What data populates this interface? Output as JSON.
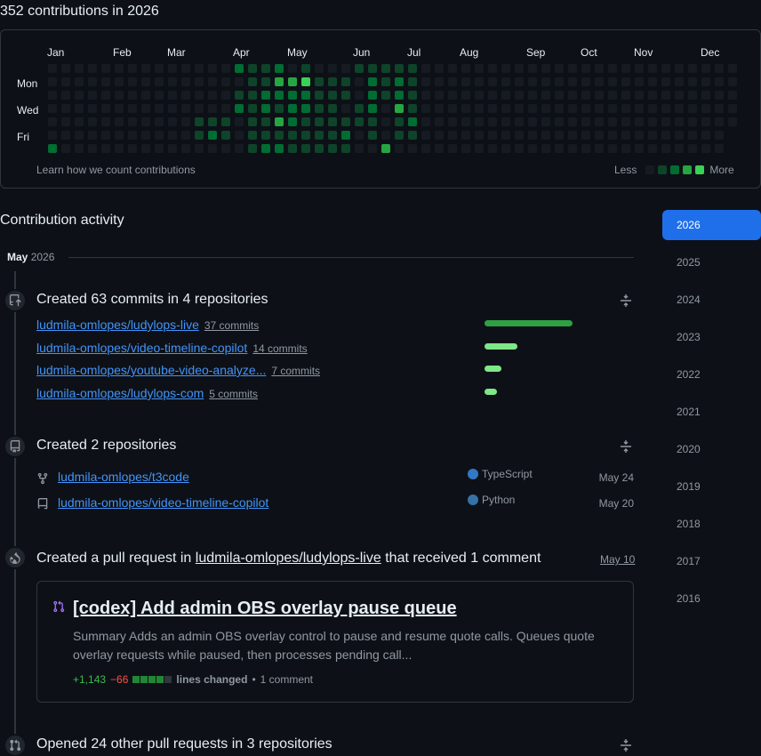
{
  "contributions": {
    "title": "352 contributions in 2026",
    "months": [
      "Jan",
      "Feb",
      "Mar",
      "Apr",
      "May",
      "Jun",
      "Jul",
      "Aug",
      "Sep",
      "Oct",
      "Nov",
      "Dec"
    ],
    "day_labels": [
      "Mon",
      "Wed",
      "Fri"
    ],
    "learn_link": "Learn how we count contributions",
    "legend_less": "Less",
    "legend_more": "More",
    "colors": [
      "#161b22",
      "#0e4429",
      "#006d32",
      "#26a641",
      "#39d353"
    ],
    "active_weeks": [
      [
        0,
        0,
        0,
        0,
        0,
        0,
        2
      ],
      [
        0,
        0,
        0,
        0,
        0,
        0,
        0
      ],
      [
        0,
        0,
        0,
        0,
        0,
        0,
        0
      ],
      [
        0,
        0,
        0,
        0,
        0,
        0,
        0
      ],
      [
        0,
        0,
        0,
        0,
        0,
        0,
        0
      ],
      [
        0,
        0,
        0,
        0,
        0,
        0,
        0
      ],
      [
        0,
        0,
        0,
        0,
        0,
        0,
        0
      ],
      [
        0,
        0,
        0,
        0,
        0,
        0,
        0
      ],
      [
        0,
        0,
        0,
        0,
        0,
        0,
        0
      ],
      [
        0,
        0,
        0,
        0,
        0,
        0,
        0
      ],
      [
        0,
        0,
        0,
        0,
        0,
        0,
        0
      ],
      [
        0,
        0,
        0,
        0,
        1,
        1,
        0
      ],
      [
        0,
        0,
        0,
        0,
        1,
        2,
        0
      ],
      [
        0,
        0,
        0,
        0,
        1,
        1,
        0
      ],
      [
        2,
        0,
        1,
        2,
        0,
        0,
        0
      ],
      [
        1,
        1,
        1,
        1,
        1,
        1,
        1
      ],
      [
        1,
        1,
        2,
        2,
        1,
        1,
        2
      ],
      [
        2,
        3,
        2,
        1,
        3,
        1,
        2
      ],
      [
        0,
        3,
        2,
        2,
        2,
        1,
        1
      ],
      [
        1,
        4,
        2,
        2,
        1,
        1,
        1
      ],
      [
        0,
        1,
        1,
        1,
        1,
        1,
        1
      ],
      [
        0,
        1,
        1,
        1,
        1,
        1,
        1
      ],
      [
        0,
        1,
        1,
        0,
        1,
        2,
        1
      ],
      [
        1,
        0,
        0,
        1,
        1,
        0,
        0
      ],
      [
        1,
        2,
        2,
        2,
        1,
        1,
        0
      ],
      [
        1,
        1,
        1,
        0,
        0,
        0,
        3
      ],
      [
        1,
        2,
        2,
        3,
        1,
        1,
        0
      ],
      [
        1,
        1,
        1,
        1,
        2,
        1,
        0
      ]
    ]
  },
  "activity": {
    "title": "Contribution activity",
    "month": "May",
    "year": "2026"
  },
  "years": [
    "2026",
    "2025",
    "2024",
    "2023",
    "2022",
    "2021",
    "2020",
    "2019",
    "2018",
    "2017",
    "2016"
  ],
  "commits": {
    "title": "Created 63 commits in 4 repositories",
    "repos": [
      {
        "name": "ludmila-omlopes/ludylops-live",
        "count": "37 commits",
        "value": 37
      },
      {
        "name": "ludmila-omlopes/video-timeline-copilot",
        "count": "14 commits",
        "value": 14
      },
      {
        "name": "ludmila-omlopes/youtube-video-analyze...",
        "count": "7 commits",
        "value": 7
      },
      {
        "name": "ludmila-omlopes/ludylops-com",
        "count": "5 commits",
        "value": 5
      }
    ]
  },
  "repos_created": {
    "title": "Created 2 repositories",
    "items": [
      {
        "name": "ludmila-omlopes/t3code",
        "language": "TypeScript",
        "language_color": "#3178c6",
        "date": "May 24",
        "icon": "repo-forked-icon"
      },
      {
        "name": "ludmila-omlopes/video-timeline-copilot",
        "language": "Python",
        "language_color": "#3572a5",
        "date": "May 20",
        "icon": "repo-icon"
      }
    ]
  },
  "pull_request": {
    "title_prefix": "Created a pull request in",
    "repo": "ludmila-omlopes/ludylops-live",
    "title_suffix": "that received 1 comment",
    "date": "May 10",
    "pr_title": "[codex] Add admin OBS overlay pause queue",
    "summary": "Summary Adds an admin OBS overlay control to pause and resume quote calls. Queues quote overlay requests while paused, then processes pending call...",
    "additions": "+1,143",
    "deletions": "−66",
    "lines_changed": "lines changed",
    "comments": "1 comment"
  },
  "other_prs": {
    "title": "Opened 24 other pull requests in 3 repositories"
  }
}
